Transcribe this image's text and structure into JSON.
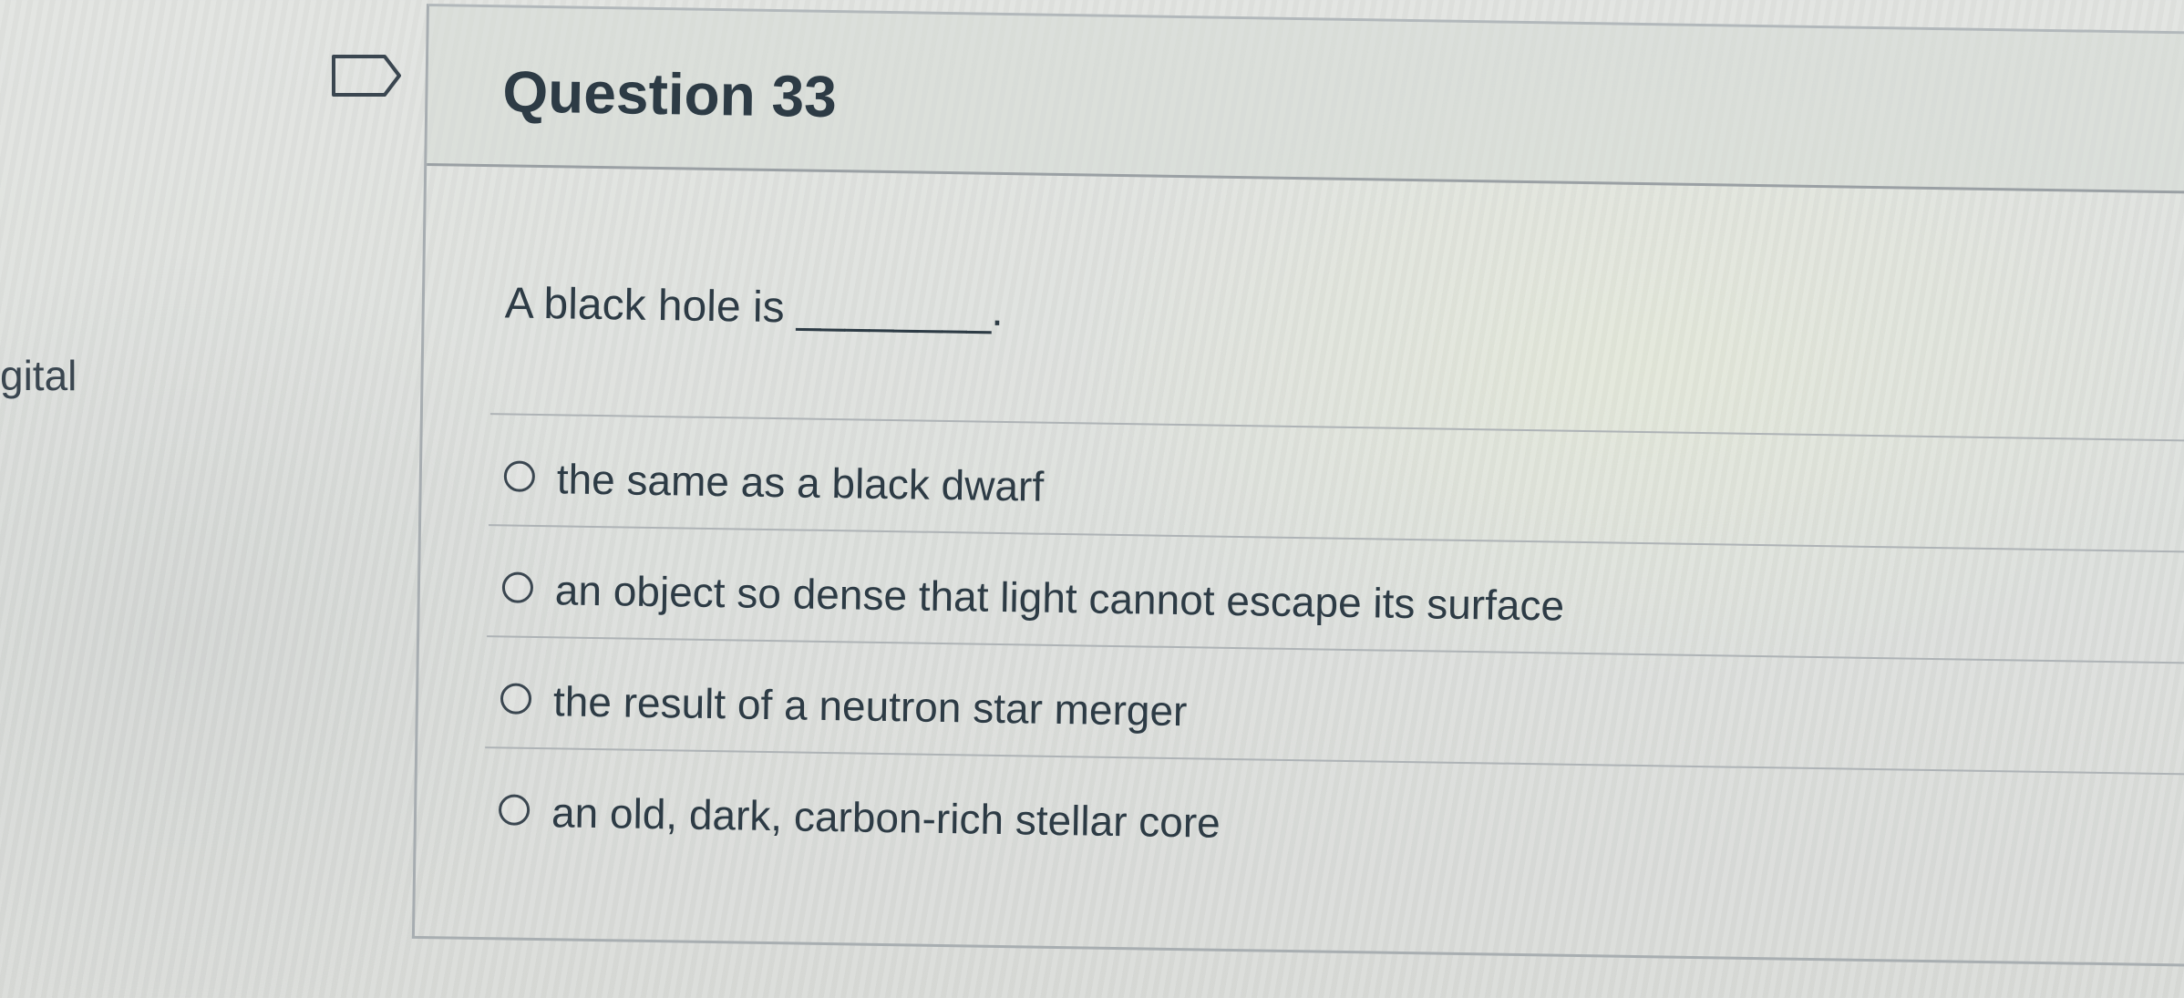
{
  "side_text": "gital",
  "question": {
    "title": "Question 33",
    "prompt": "A black hole is ________.",
    "bookmark_icon": "bookmark-flag-icon",
    "answers": [
      {
        "label": "the same as a black dwarf",
        "selected": false
      },
      {
        "label": "an object so dense that light cannot escape its surface",
        "selected": false
      },
      {
        "label": "the result of a neutron star merger",
        "selected": false
      },
      {
        "label": "an old, dark, carbon-rich stellar core",
        "selected": false
      }
    ]
  }
}
